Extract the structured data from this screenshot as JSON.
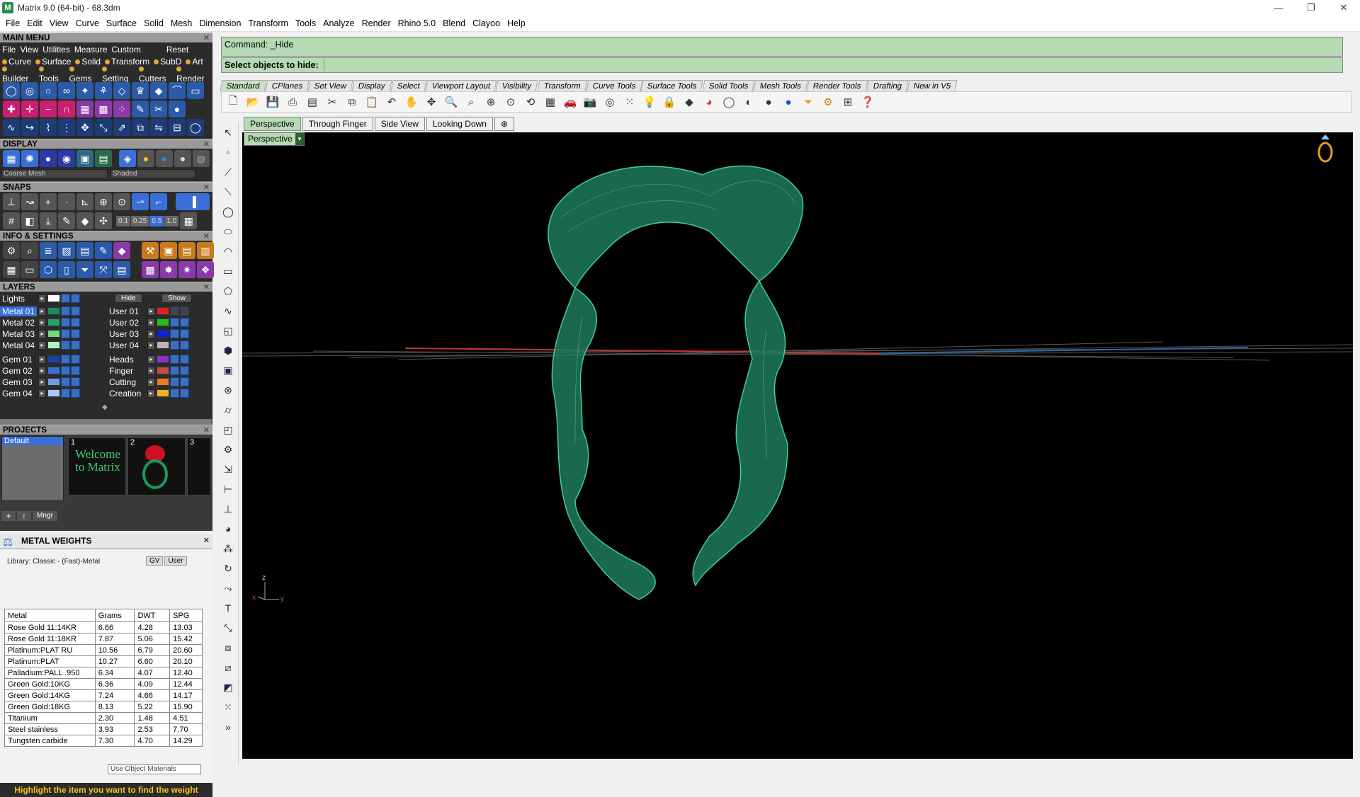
{
  "window": {
    "title": "Matrix 9.0 (64-bit) - 68.3dm",
    "controls": [
      "—",
      "❐",
      "✕"
    ]
  },
  "menubar": [
    "File",
    "Edit",
    "View",
    "Curve",
    "Surface",
    "Solid",
    "Mesh",
    "Dimension",
    "Transform",
    "Tools",
    "Analyze",
    "Render",
    "Rhino 5.0",
    "Blend",
    "Clayoo",
    "Help"
  ],
  "main_menu": {
    "title": "MAIN MENU",
    "row1": [
      "File",
      "View",
      "Utilities",
      "Measure",
      "Custom",
      "Reset"
    ],
    "row2": [
      "Curve",
      "Surface",
      "Solid",
      "Transform",
      "SubD",
      "Art"
    ],
    "row3": [
      "Builder",
      "Tools",
      "Gems",
      "Setting",
      "Cutters",
      "Render"
    ]
  },
  "display": {
    "title": "DISPLAY",
    "mesh_select": "Coarse Mesh",
    "shade_select": "Shaded"
  },
  "snaps": {
    "title": "SNAPS",
    "values": [
      "0.1",
      "0.25",
      "0.5",
      "1.0"
    ]
  },
  "info": {
    "title": "INFO & SETTINGS"
  },
  "layers": {
    "title": "LAYERS",
    "lights": "Lights",
    "hide": "Hide",
    "show": "Show",
    "left": [
      {
        "name": "Metal 01",
        "color": "#1f8a5a",
        "sel": true
      },
      {
        "name": "Metal 02",
        "color": "#1fa86b"
      },
      {
        "name": "Metal 03",
        "color": "#6fdc7a"
      },
      {
        "name": "Metal 04",
        "color": "#b6f0c0"
      },
      {
        "name": "Gem 01",
        "color": "#1b3fa8"
      },
      {
        "name": "Gem 02",
        "color": "#3a6fd8"
      },
      {
        "name": "Gem 03",
        "color": "#6d9ce8"
      },
      {
        "name": "Gem 04",
        "color": "#a8c8f5"
      }
    ],
    "right": [
      {
        "name": "User 01",
        "color": "#e02020"
      },
      {
        "name": "User 02",
        "color": "#20c020"
      },
      {
        "name": "User 03",
        "color": "#1020e0"
      },
      {
        "name": "User 04",
        "color": "#b8b8b8"
      },
      {
        "name": "Heads",
        "color": "#8a2fc8"
      },
      {
        "name": "Finger",
        "color": "#c84a4a"
      },
      {
        "name": "Cutting",
        "color": "#f07a1a"
      },
      {
        "name": "Creation",
        "color": "#f5b020"
      }
    ]
  },
  "projects": {
    "title": "PROJECTS",
    "default": "Default",
    "mngr": "Mngr",
    "thumbs": [
      {
        "num": "1",
        "text": "Welcome to Matrix"
      },
      {
        "num": "2",
        "text": ""
      },
      {
        "num": "3",
        "text": ""
      }
    ]
  },
  "metal_weights": {
    "title": "METAL WEIGHTS",
    "library": "Library: Classic - (Fast)-Metal",
    "gv": "GV",
    "user": "User",
    "columns": [
      "Metal",
      "Grams",
      "DWT",
      "SPG"
    ],
    "rows": [
      [
        "Rose Gold 11:14KR",
        "6.66",
        "4.28",
        "13.03"
      ],
      [
        "Rose Gold 11:18KR",
        "7.87",
        "5.06",
        "15.42"
      ],
      [
        "Platinum:PLAT RU",
        "10.56",
        "6.79",
        "20.60"
      ],
      [
        "Platinum:PLAT",
        "10.27",
        "6.60",
        "20.10"
      ],
      [
        "Palladium:PALL .950",
        "6.34",
        "4.07",
        "12.40"
      ],
      [
        "Green Gold:10KG",
        "6.36",
        "4.09",
        "12.44"
      ],
      [
        "Green Gold:14KG",
        "7.24",
        "4.66",
        "14.17"
      ],
      [
        "Green Gold:18KG",
        "8.13",
        "5.22",
        "15.90"
      ],
      [
        "Titanium",
        "2.30",
        "1.48",
        "4.51"
      ],
      [
        "Steel stainless",
        "3.93",
        "2.53",
        "7.70"
      ],
      [
        "Tungsten carbide",
        "7.30",
        "4.70",
        "14.29"
      ]
    ],
    "use_object_materials": "Use Object Materials",
    "hint": "Highlight the item you want to find the weight"
  },
  "command": {
    "history": "Command: _Hide",
    "prompt": "Select objects to hide:"
  },
  "toolbar_tabs": [
    "Standard",
    "CPlanes",
    "Set View",
    "Display",
    "Select",
    "Viewport Layout",
    "Visibility",
    "Transform",
    "Curve Tools",
    "Surface Tools",
    "Solid Tools",
    "Mesh Tools",
    "Render Tools",
    "Drafting",
    "New in V5"
  ],
  "viewport_tabs": [
    "Perspective",
    "Through Finger",
    "Side View",
    "Looking Down"
  ],
  "viewport": {
    "label": "Perspective",
    "axis_z": "z",
    "axis_x": "x",
    "axis_y": "y",
    "model_color": "#2fa878"
  }
}
